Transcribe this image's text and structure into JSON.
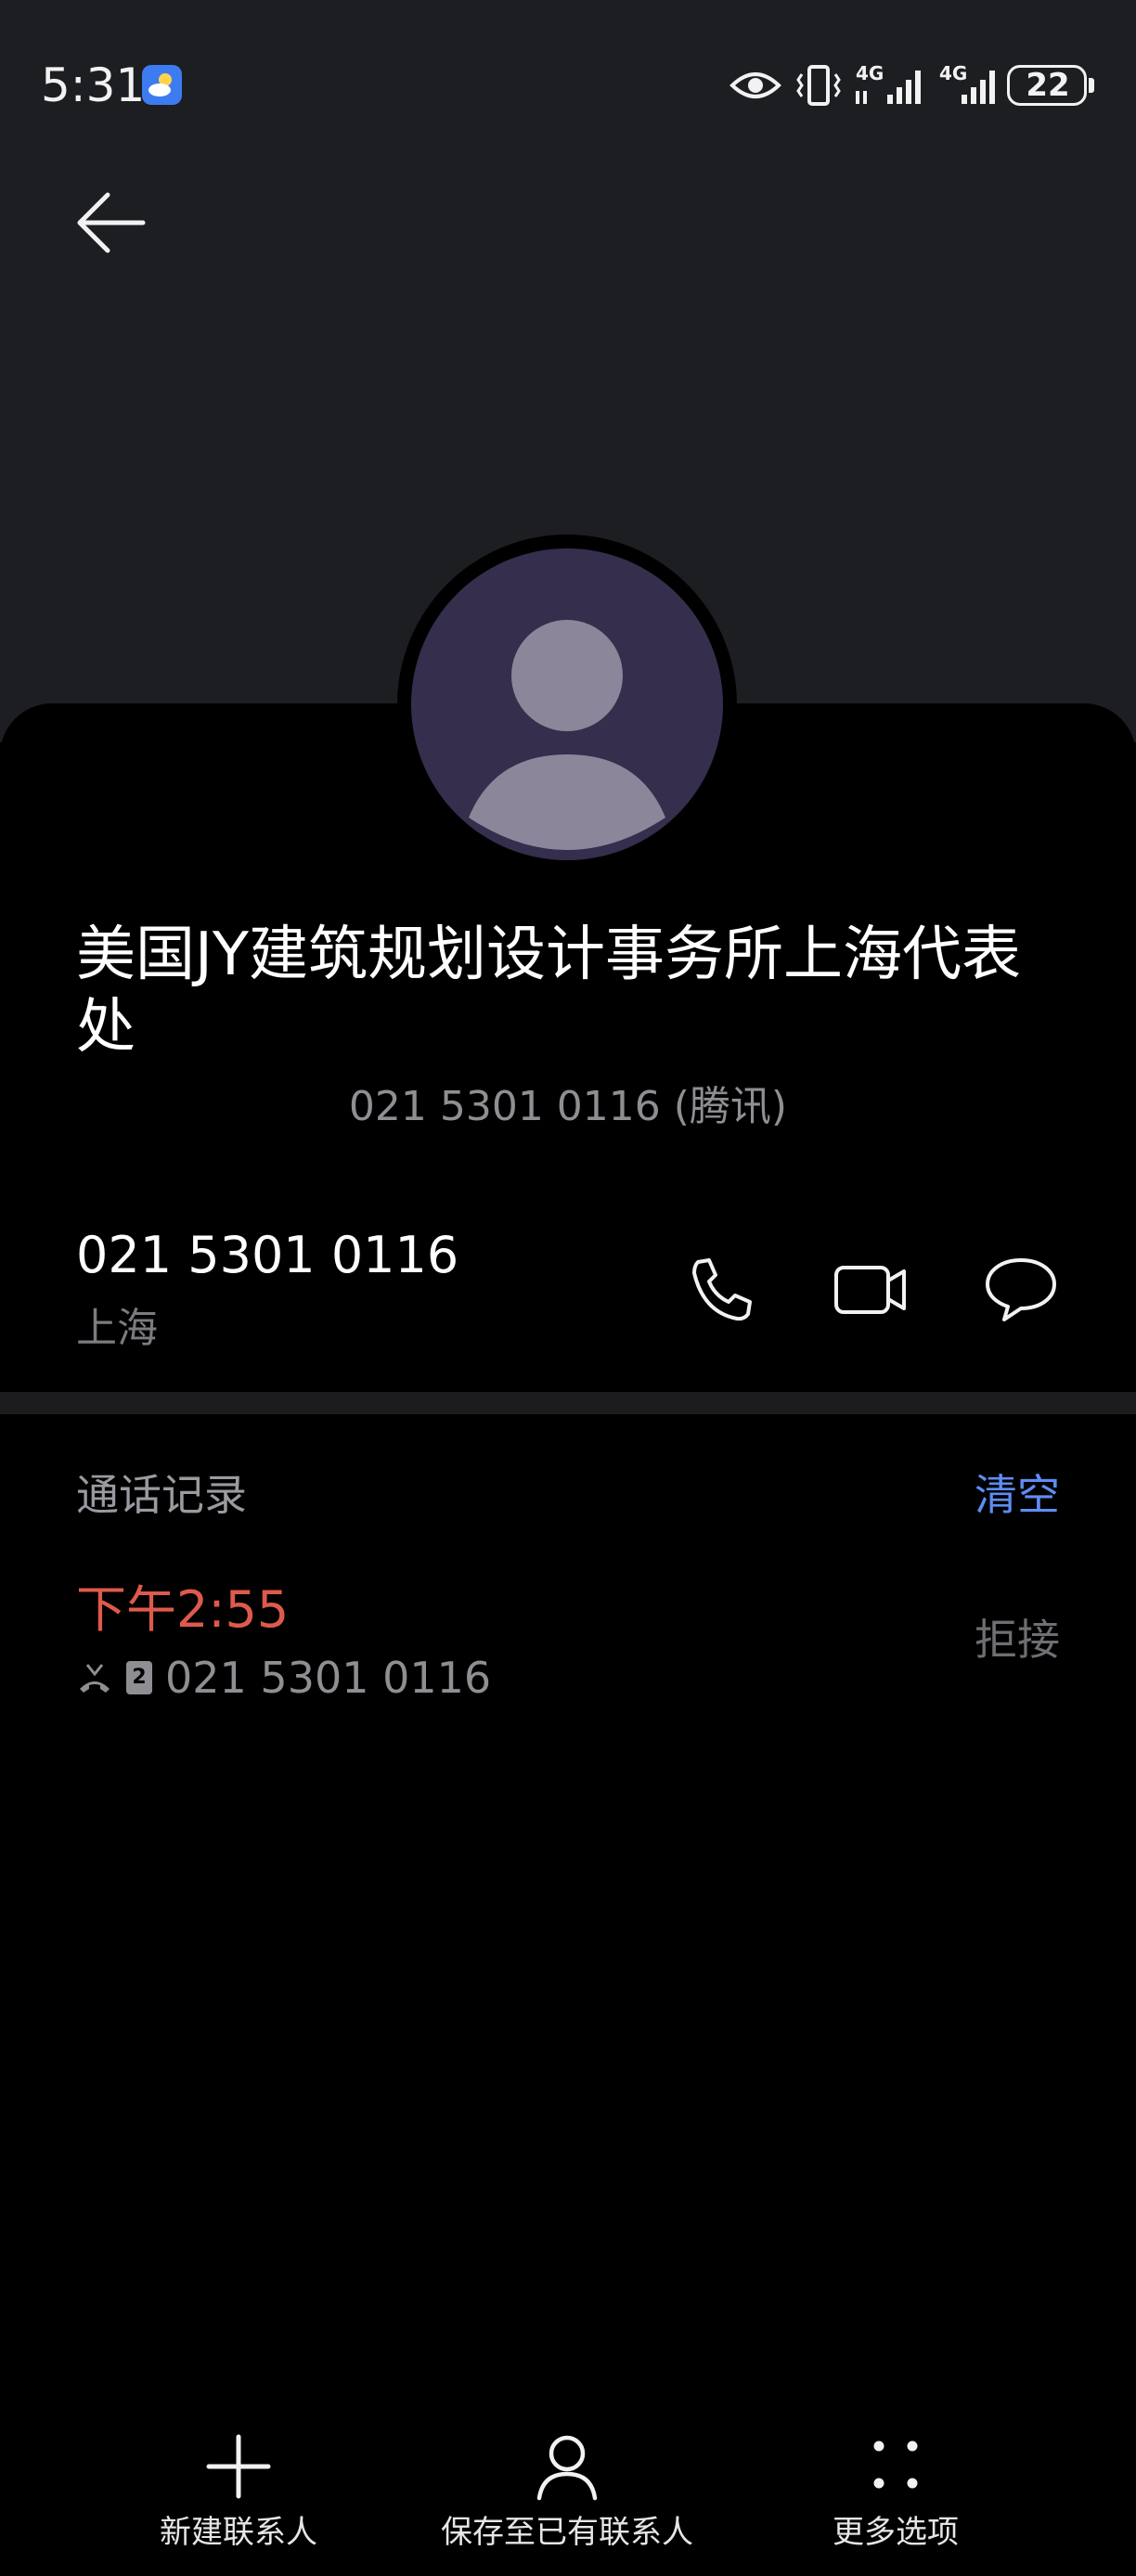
{
  "status_bar": {
    "time": "5:31",
    "network_1": "4G",
    "network_2": "4G",
    "battery": "22"
  },
  "contact": {
    "name": "美国JY建筑规划设计事务所上海代表处",
    "subtitle": "021 5301 0116 (腾讯)",
    "phone": "021 5301 0116",
    "location": "上海"
  },
  "call_log": {
    "title": "通话记录",
    "clear_label": "清空",
    "entries": [
      {
        "time": "下午2:55",
        "sim": "2",
        "number": "021 5301 0116",
        "status": "拒接"
      }
    ]
  },
  "bottom_bar": {
    "new_contact": "新建联系人",
    "save_existing": "保存至已有联系人",
    "more_options": "更多选项"
  },
  "colors": {
    "missed": "#dd5a4c",
    "accent": "#5f8cf5",
    "avatar": "#352e4c"
  }
}
